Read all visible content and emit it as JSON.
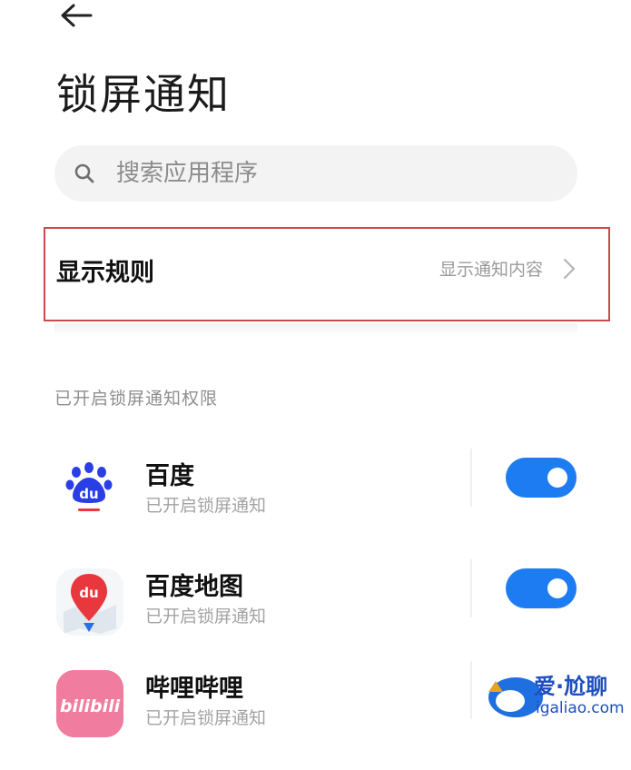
{
  "header": {
    "title": "锁屏通知"
  },
  "search": {
    "placeholder": "搜索应用程序"
  },
  "display_rule": {
    "label": "显示规则",
    "value": "显示通知内容"
  },
  "section": {
    "header": "已开启锁屏通知权限"
  },
  "apps": [
    {
      "name": "百度",
      "status": "已开启锁屏通知",
      "icon": "baidu-icon",
      "enabled": true
    },
    {
      "name": "百度地图",
      "status": "已开启锁屏通知",
      "icon": "baidu-map-icon",
      "enabled": true
    },
    {
      "name": "哔哩哔哩",
      "status": "已开启锁屏通知",
      "icon": "bilibili-icon",
      "enabled": true
    }
  ],
  "watermark": {
    "text": "爱·尬聊",
    "site": "igaliao.com"
  },
  "colors": {
    "accent": "#1d7cf2",
    "highlight_border": "#c94a4a"
  }
}
